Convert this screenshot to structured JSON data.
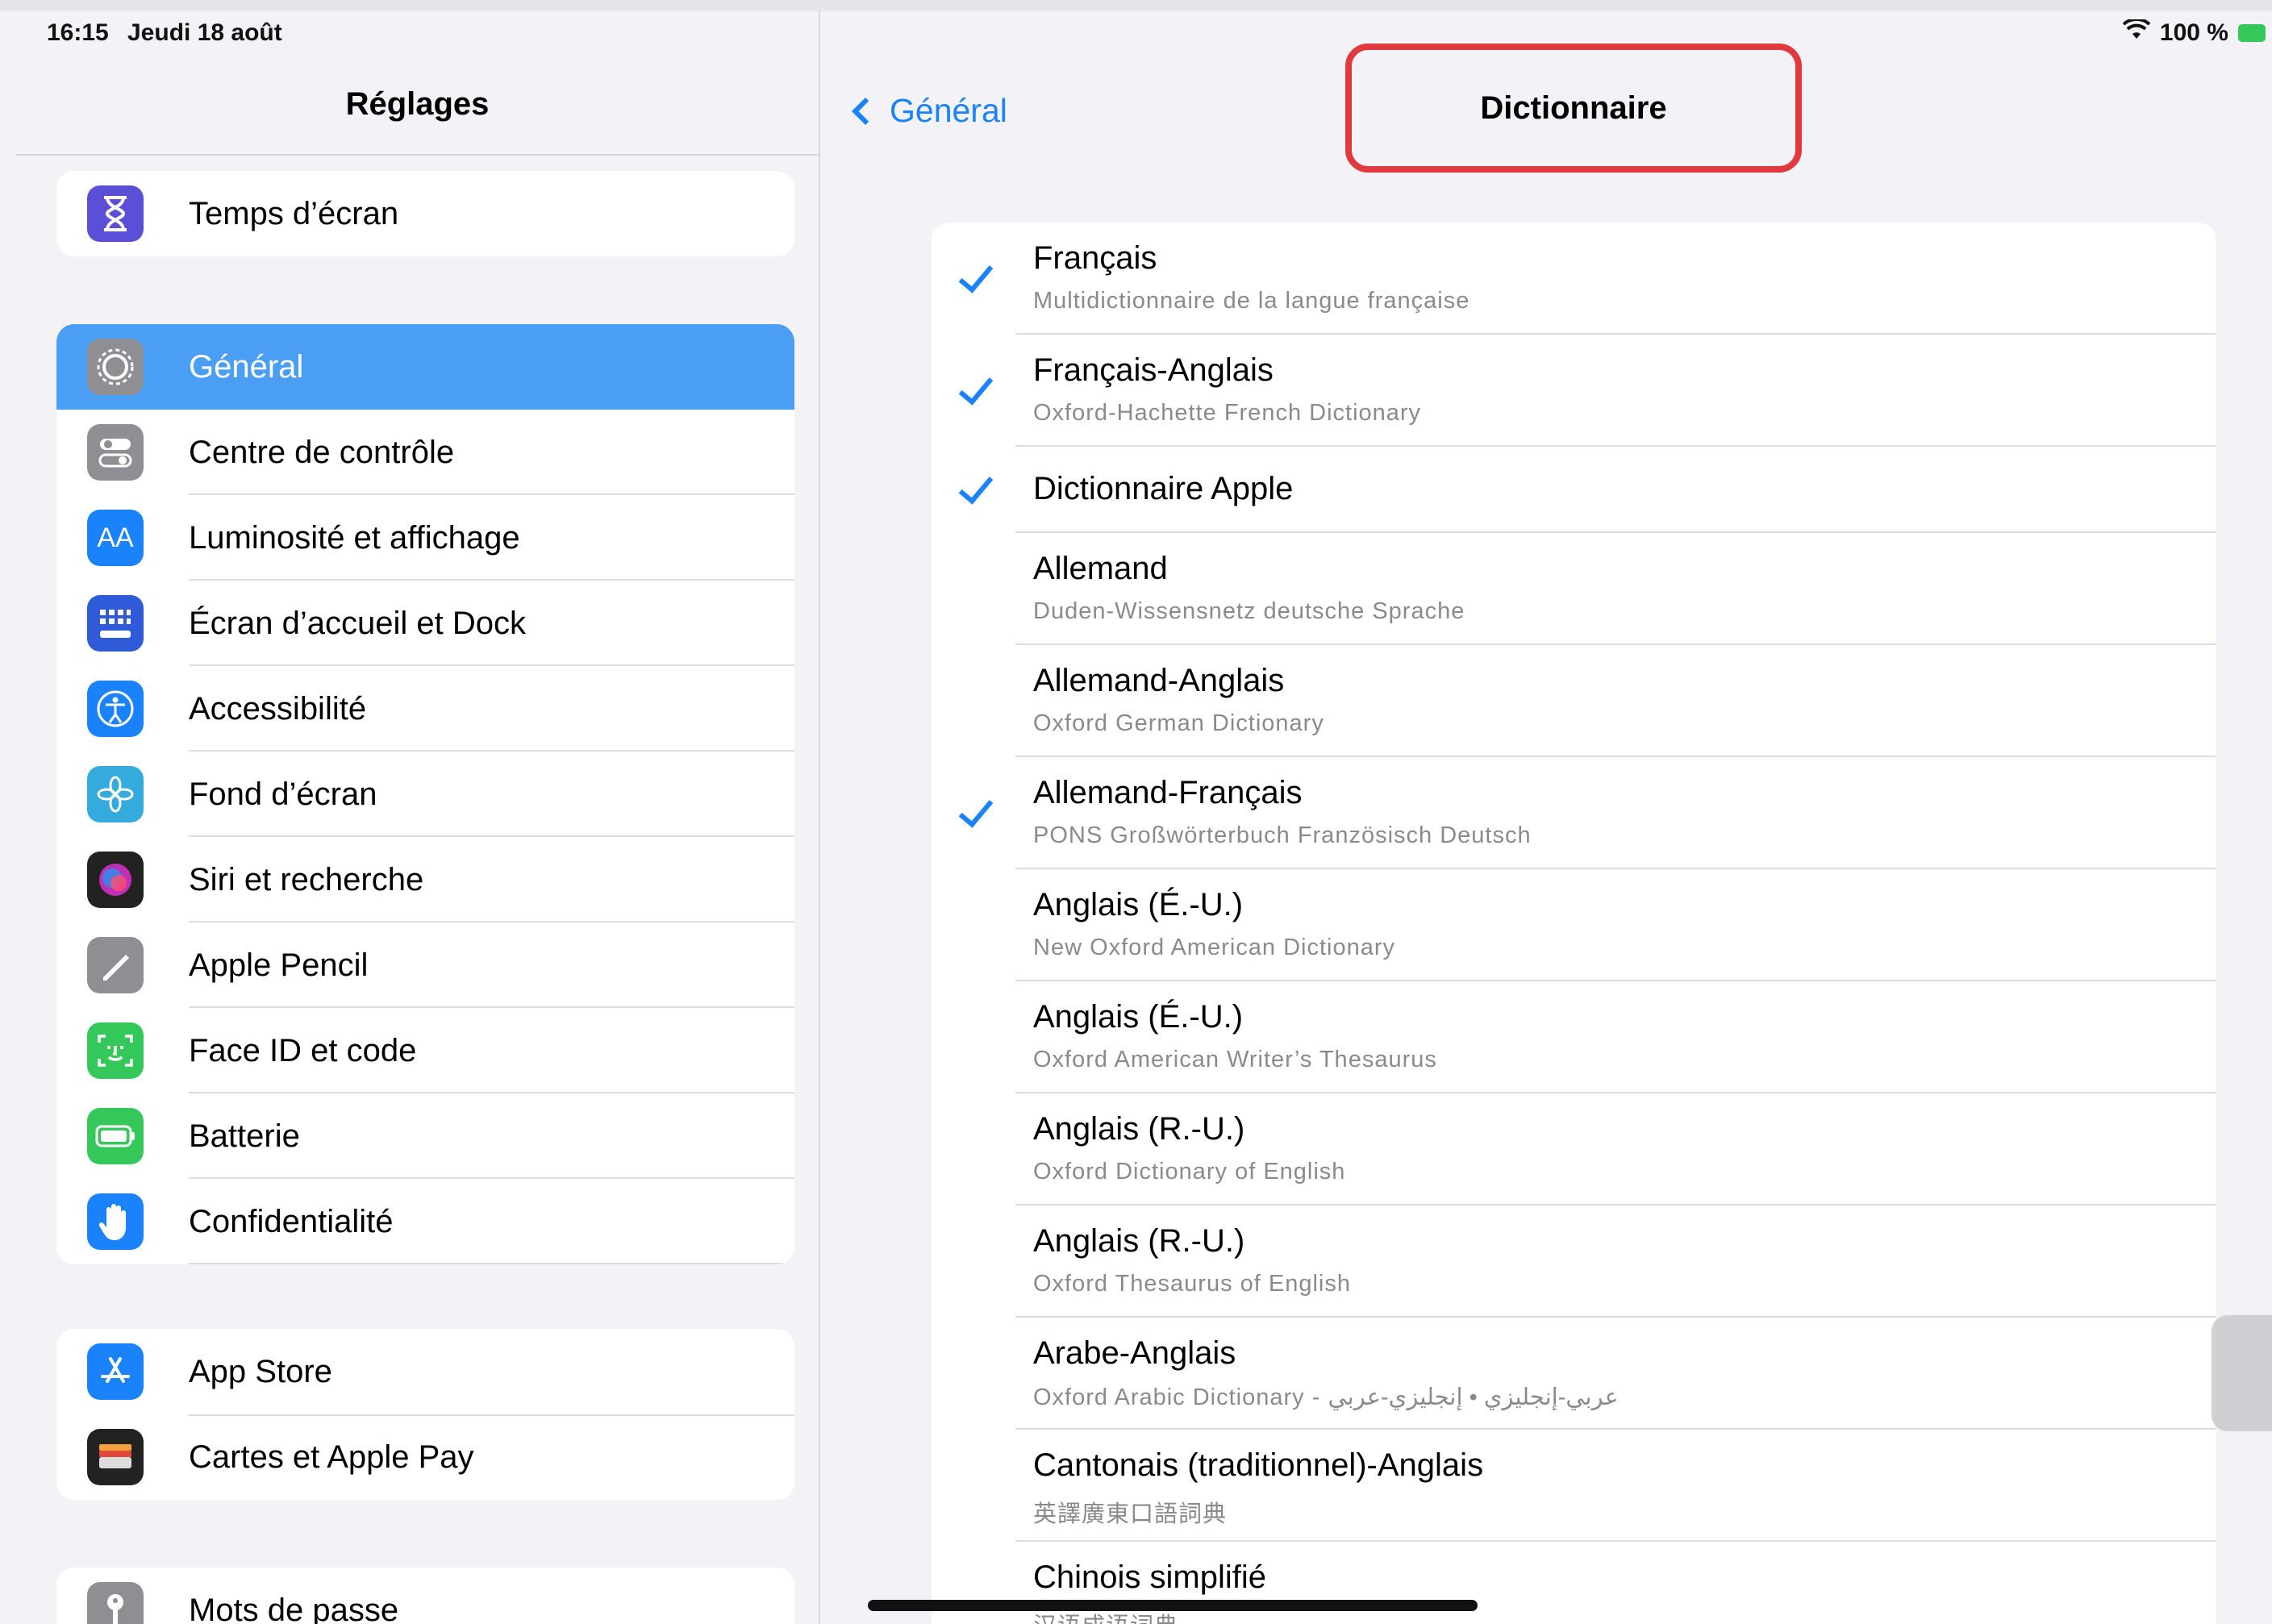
{
  "status_bar": {
    "time": "16:15",
    "date": "Jeudi 18 août",
    "battery": "100 %"
  },
  "sidebar": {
    "title": "Réglages",
    "groups": [
      {
        "items": [
          {
            "label": "Temps d’écran",
            "icon": "hourglass-icon",
            "color": "#5a4fd6"
          }
        ]
      },
      {
        "items": [
          {
            "label": "Général",
            "icon": "gear-icon",
            "color": "#8e8e93",
            "selected": true
          },
          {
            "label": "Centre de contrôle",
            "icon": "toggles-icon",
            "color": "#8e8e93"
          },
          {
            "label": "Luminosité et affichage",
            "icon": "text-size-icon",
            "color": "#1a82fb"
          },
          {
            "label": "Écran d’accueil et Dock",
            "icon": "app-grid-icon",
            "color": "#2f5bd8"
          },
          {
            "label": "Accessibilité",
            "icon": "accessibility-icon",
            "color": "#1a82fb"
          },
          {
            "label": "Fond d’écran",
            "icon": "flower-icon",
            "color": "#35aadc"
          },
          {
            "label": "Siri et recherche",
            "icon": "siri-icon",
            "color": "#222222"
          },
          {
            "label": "Apple Pencil",
            "icon": "pencil-icon",
            "color": "#8e8e93"
          },
          {
            "label": "Face ID et code",
            "icon": "face-id-icon",
            "color": "#34c759"
          },
          {
            "label": "Batterie",
            "icon": "battery-icon",
            "color": "#34c759"
          },
          {
            "label": "Confidentialité",
            "icon": "hand-icon",
            "color": "#1a82fb"
          }
        ]
      },
      {
        "items": [
          {
            "label": "App Store",
            "icon": "app-store-icon",
            "color": "#1a82fb"
          },
          {
            "label": "Cartes et Apple Pay",
            "icon": "wallet-icon",
            "color": "#222222"
          }
        ]
      },
      {
        "items": [
          {
            "label": "Mots de passe",
            "icon": "key-icon",
            "color": "#8e8e93"
          }
        ]
      }
    ]
  },
  "nav": {
    "back_label": "Général",
    "title": "Dictionnaire"
  },
  "dictionaries": [
    {
      "name": "Français",
      "subtitle": "Multidictionnaire de la langue française",
      "checked": true
    },
    {
      "name": "Français-Anglais",
      "subtitle": "Oxford-Hachette French Dictionary",
      "checked": true
    },
    {
      "name": "Dictionnaire Apple",
      "subtitle": "",
      "checked": true
    },
    {
      "name": "Allemand",
      "subtitle": "Duden-Wissensnetz deutsche Sprache",
      "checked": false
    },
    {
      "name": "Allemand-Anglais",
      "subtitle": "Oxford German Dictionary",
      "checked": false
    },
    {
      "name": "Allemand-Français",
      "subtitle": "PONS Großwörterbuch Französisch Deutsch",
      "checked": true
    },
    {
      "name": "Anglais (É.-U.)",
      "subtitle": "New Oxford American Dictionary",
      "checked": false
    },
    {
      "name": "Anglais (É.-U.)",
      "subtitle": "Oxford American Writer’s Thesaurus",
      "checked": false
    },
    {
      "name": "Anglais (R.-U.)",
      "subtitle": "Oxford Dictionary of English",
      "checked": false
    },
    {
      "name": "Anglais (R.-U.)",
      "subtitle": "Oxford Thesaurus of English",
      "checked": false
    },
    {
      "name": "Arabe-Anglais",
      "subtitle": "Oxford Arabic Dictionary - عربي-إنجليزي • إنجليزي-عربي",
      "checked": false
    },
    {
      "name": "Cantonais (traditionnel)-Anglais",
      "subtitle": "英譯廣東口語詞典",
      "checked": false
    },
    {
      "name": "Chinois simplifié",
      "subtitle": "汉语成语词典",
      "checked": false
    }
  ],
  "colors": {
    "accent": "#1a82fb",
    "selected_row": "#4a9ff5",
    "highlight_box": "#e0393e"
  }
}
